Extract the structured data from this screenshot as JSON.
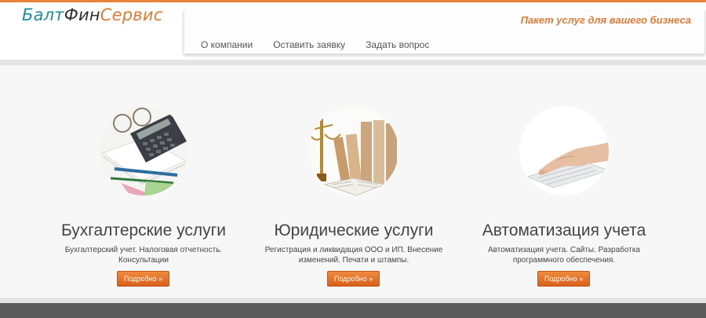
{
  "logo": {
    "part1": "Балт",
    "part2": "Фин",
    "part3": "Сервис"
  },
  "tagline": "Пакет услуг для вашего бизнеса",
  "nav": [
    "О компании",
    "Оставить заявку",
    "Задать вопрос"
  ],
  "features": [
    {
      "title": "Бухгалтерские услуги",
      "text": "Бухгалтерский учет. Налоговая отчетность. Консультации",
      "button": "Подробно »",
      "icon": "calculator-image"
    },
    {
      "title": "Юридические услуги",
      "text": "Регистрация и ликвидация ООО и ИП. Внесение изменений. Печати и штампы.",
      "button": "Подробно »",
      "icon": "scales-books-image"
    },
    {
      "title": "Автоматизация учета",
      "text": "Автоматизация учета. Сайты. Разработка программного обеспечения.",
      "button": "Подробно »",
      "icon": "keyboard-hand-image"
    }
  ],
  "colors": {
    "accent": "#e07a34",
    "teal": "#1a8d9e",
    "footer": "#5b5b5b"
  }
}
